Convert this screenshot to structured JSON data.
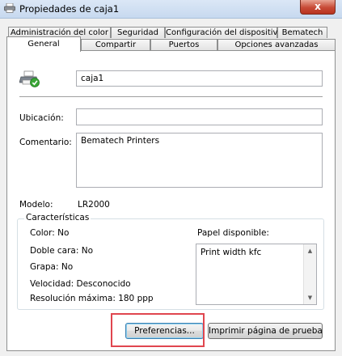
{
  "window": {
    "title": "Propiedades de caja1",
    "close_glyph": "x"
  },
  "tabs_row1": [
    "Administración del color",
    "Seguridad",
    "Configuración del dispositivo",
    "Bematech"
  ],
  "tabs_row2": [
    "General",
    "Compartir",
    "Puertos",
    "Opciones avanzadas"
  ],
  "active_tab": "General",
  "general": {
    "printer_name": "caja1",
    "location_label": "Ubicación:",
    "location_value": "",
    "comment_label": "Comentario:",
    "comment_value": "Bematech Printers",
    "model_label": "Modelo:",
    "model_value": "LR2000"
  },
  "features": {
    "title": "Características",
    "color": "Color: No",
    "duplex": "Doble cara: No",
    "staple": "Grapa: No",
    "speed": "Velocidad: Desconocido",
    "resolution": "Resolución máxima: 180 ppp",
    "paper_label": "Papel disponible:",
    "paper_items": [
      "Print width kfc"
    ]
  },
  "buttons": {
    "preferences": "Preferencias...",
    "print_test": "Imprimir página de prueba"
  },
  "icons": {
    "window_icon": "printer-icon",
    "printer_icon": "printer-ready-icon"
  }
}
